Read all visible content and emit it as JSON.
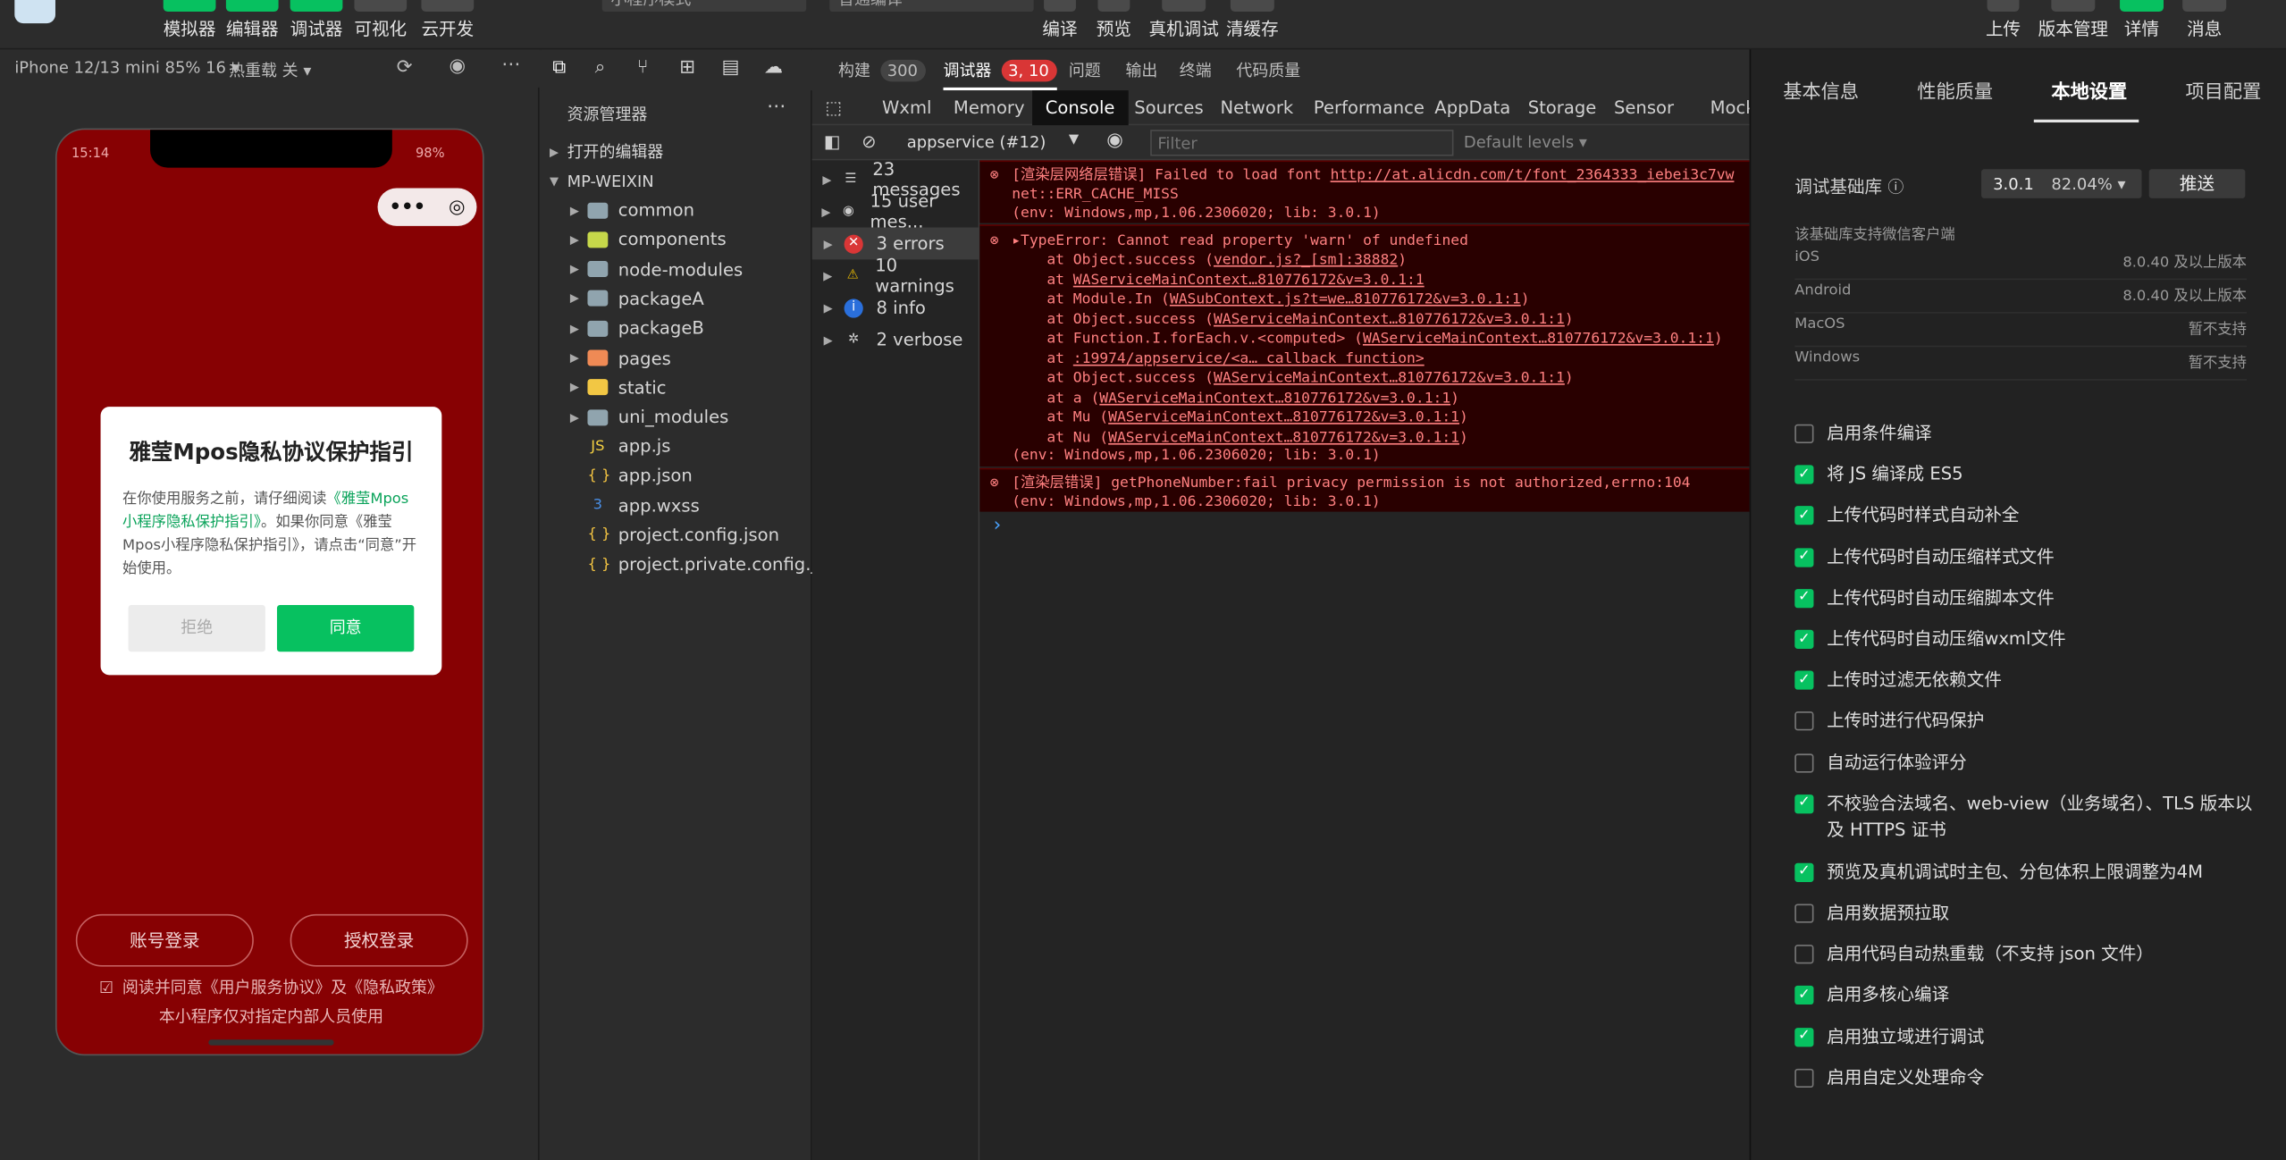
{
  "toolbar": {
    "simulator": "模拟器",
    "editor": "编辑器",
    "debugger": "调试器",
    "visual": "可视化",
    "cloud": "云开发",
    "mode_select": "小程序模式",
    "compile_select": "普通编译",
    "compile": "编译",
    "preview": "预览",
    "real_debug": "真机调试",
    "clear_cache": "清缓存",
    "upload": "上传",
    "version": "版本管理",
    "details": "详情",
    "messages": "消息"
  },
  "simbar": {
    "device": "iPhone 12/13 mini 85% 16 ▾",
    "hot_reload": "热重载 关 ▾"
  },
  "phone": {
    "time": "15:14",
    "battery": "98%",
    "capsule_more": "•••",
    "dialog_title": "雅莹Mpos隐私协议保护指引",
    "dialog_text_1": "在你使用服务之前，请仔细阅读",
    "dialog_link": "《雅莹Mpos小程序隐私保护指引》",
    "dialog_text_2": "。如果你同意《雅莹Mpos小程序隐私保护指引》，请点击“同意”开始使用。",
    "reject": "拒绝",
    "agree": "同意",
    "account_login": "账号登录",
    "auth_login": "授权登录",
    "agree_row": "阅读并同意《用户服务协议》及《隐私政策》",
    "internal_note": "本小程序仅对指定内部人员使用"
  },
  "explorer": {
    "title": "资源管理器",
    "open_editors": "打开的编辑器",
    "project": "MP-WEIXIN",
    "folders": [
      "common",
      "components",
      "node-modules",
      "packageA",
      "packageB",
      "pages",
      "static",
      "uni_modules"
    ],
    "files": [
      "app.js",
      "app.json",
      "app.wxss",
      "project.config.json",
      "project.private.config.js..."
    ]
  },
  "devtools": {
    "tabs": {
      "build": "构建",
      "build_count": "300",
      "debugger": "调试器",
      "debugger_count": "3, 10",
      "problems": "问题",
      "output": "输出",
      "terminal": "终端",
      "code_quality": "代码质量"
    },
    "subtabs": [
      "Wxml",
      "Memory",
      "Console",
      "Sources",
      "Network",
      "Performance",
      "AppData",
      "Storage",
      "Sensor",
      "Mock"
    ],
    "context": "appservice (#12)",
    "filter_placeholder": "Filter",
    "levels": "Default levels ▾",
    "side": [
      "23 messages",
      "15 user mes...",
      "3 errors",
      "10 warnings",
      "8 info",
      "2 verbose"
    ]
  },
  "console": {
    "e1_l1_pre": "[渲染层网络层错误] Failed to load font ",
    "e1_l1_link": "http://at.alicdn.com/t/font_2364333_iebei3c7vw",
    "e1_l2": "net::ERR_CACHE_MISS",
    "e1_l3": "(env: Windows,mp,1.06.2306020; lib: 3.0.1)",
    "e2_l1": "▸TypeError: Cannot read property 'warn' of undefined",
    "e2_stack": [
      [
        "at Object.success (",
        "vendor.js?_[sm]:38882",
        ")"
      ],
      [
        "at ",
        "WAServiceMainContext…810776172&v=3.0.1:1",
        ""
      ],
      [
        "at Module.In (",
        "WASubContext.js?t=we…810776172&v=3.0.1:1",
        ")"
      ],
      [
        "at Object.success (",
        "WAServiceMainContext…810776172&v=3.0.1:1",
        ")"
      ],
      [
        "at Function.I.forEach.v.<computed> (",
        "WAServiceMainContext…810776172&v=3.0.1:1",
        ")"
      ],
      [
        "at ",
        ":19974/appservice/<a… callback function>",
        ""
      ],
      [
        "at Object.success (",
        "WAServiceMainContext…810776172&v=3.0.1:1",
        ")"
      ],
      [
        "at a (",
        "WAServiceMainContext…810776172&v=3.0.1:1",
        ")"
      ],
      [
        "at Mu (",
        "WAServiceMainContext…810776172&v=3.0.1:1",
        ")"
      ],
      [
        "at Nu (",
        "WAServiceMainContext…810776172&v=3.0.1:1",
        ")"
      ]
    ],
    "e2_env": "(env: Windows,mp,1.06.2306020; lib: 3.0.1)",
    "e3_l1": "[渲染层错误] getPhoneNumber:fail privacy permission is not authorized,errno:104",
    "e3_l2": "(env: Windows,mp,1.06.2306020; lib: 3.0.1)",
    "prompt": "›"
  },
  "right": {
    "tabs": [
      "基本信息",
      "性能质量",
      "本地设置",
      "项目配置"
    ],
    "base_lib_label": "调试基础库",
    "base_lib_version": "3.0.1",
    "base_lib_pct": "82.04% ▾",
    "push": "推送",
    "support_title": "该基础库支持微信客户端",
    "support": [
      [
        "iOS",
        "8.0.40 及以上版本"
      ],
      [
        "Android",
        "8.0.40 及以上版本"
      ],
      [
        "MacOS",
        "暂不支持"
      ],
      [
        "Windows",
        "暂不支持"
      ]
    ],
    "options": [
      {
        "label": "启用条件编译",
        "checked": false
      },
      {
        "label": "将 JS 编译成 ES5",
        "checked": true
      },
      {
        "label": "上传代码时样式自动补全",
        "checked": true
      },
      {
        "label": "上传代码时自动压缩样式文件",
        "checked": true
      },
      {
        "label": "上传代码时自动压缩脚本文件",
        "checked": true
      },
      {
        "label": "上传代码时自动压缩wxml文件",
        "checked": true
      },
      {
        "label": "上传时过滤无依赖文件",
        "checked": true
      },
      {
        "label": "上传时进行代码保护",
        "checked": false
      },
      {
        "label": "自动运行体验评分",
        "checked": false
      },
      {
        "label": "不校验合法域名、web-view（业务域名）、TLS 版本以及 HTTPS 证书",
        "checked": true
      },
      {
        "label": "预览及真机调试时主包、分包体积上限调整为4M",
        "checked": true
      },
      {
        "label": "启用数据预拉取",
        "checked": false
      },
      {
        "label": "启用代码自动热重载（不支持 json 文件）",
        "checked": false
      },
      {
        "label": "启用多核心编译",
        "checked": true
      },
      {
        "label": "启用独立域进行调试",
        "checked": true
      },
      {
        "label": "启用自定义处理命令",
        "checked": false
      }
    ]
  },
  "colors": {
    "accent": "#07c160",
    "phone_bg": "#870103",
    "error_bg": "#290000"
  }
}
